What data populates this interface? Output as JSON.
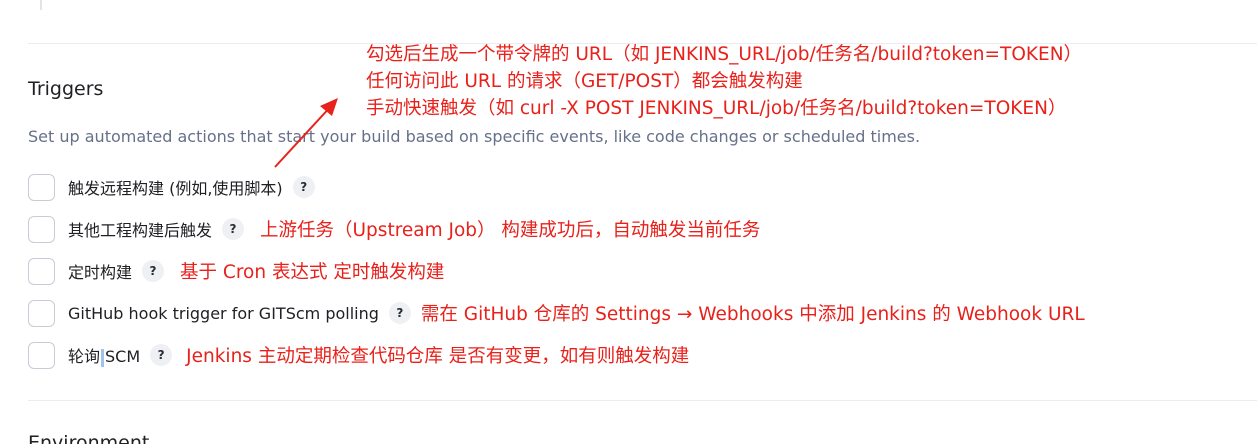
{
  "section": {
    "title": "Triggers",
    "description": "Set up automated actions that start your build based on specific events, like code changes or scheduled times.",
    "next_heading": "Environment"
  },
  "triggers": [
    {
      "label": "触发远程构建 (例如,使用脚本)",
      "help": "?",
      "annotation": ""
    },
    {
      "label": "其他工程构建后触发",
      "help": "?",
      "annotation": "上游任务（Upstream Job） 构建成功后，自动触发当前任务"
    },
    {
      "label": "定时构建",
      "help": "?",
      "annotation": "基于 Cron 表达式 定时触发构建"
    },
    {
      "label": "GitHub hook trigger for GITScm polling",
      "help": "?",
      "annotation": "需在 GitHub 仓库的 Settings → Webhooks 中添加 Jenkins 的 Webhook URL"
    },
    {
      "label_a": "轮询",
      "label_b": "SCM",
      "help": "?",
      "annotation": "Jenkins 主动定期检查代码仓库 是否有变更，如有则触发构建"
    }
  ],
  "callout": {
    "line1": "勾选后生成一个带令牌的 URL（如 JENKINS_URL/job/任务名/build?token=TOKEN）",
    "line2": "任何访问此 URL 的请求（GET/POST）都会触发构建",
    "line3": "手动快速触发（如 curl -X POST JENKINS_URL/job/任务名/build?token=TOKEN）"
  },
  "colors": {
    "annotation": "#e8211b",
    "description": "#66708a",
    "checkbox_border": "#c9ccd6"
  }
}
